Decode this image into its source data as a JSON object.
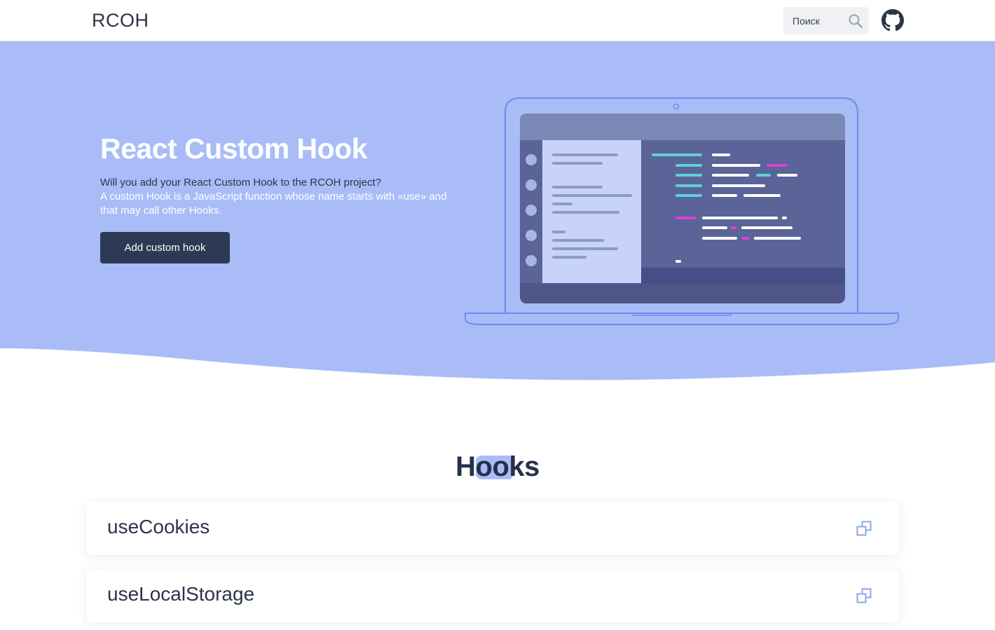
{
  "header": {
    "logo": "RCOH",
    "search": {
      "placeholder": "Поиск",
      "icon": "search-icon"
    },
    "github_icon": "github-icon"
  },
  "hero": {
    "title": "React Custom Hook",
    "question": "Will you add your React Custom Hook to the RCOH project?",
    "description": "A custom Hook is a JavaScript function whose name starts with «use» and that may call other Hooks.",
    "button_label": "Add custom hook",
    "illustration": "laptop-code-editor",
    "colors": {
      "hero_bg": "#a9bcf7",
      "button_bg": "#2d3a55"
    }
  },
  "hooks_section": {
    "title": "Hooks",
    "items": [
      {
        "name": "useCookies",
        "icon": "open-external-icon"
      },
      {
        "name": "useLocalStorage",
        "icon": "open-external-icon"
      }
    ]
  }
}
